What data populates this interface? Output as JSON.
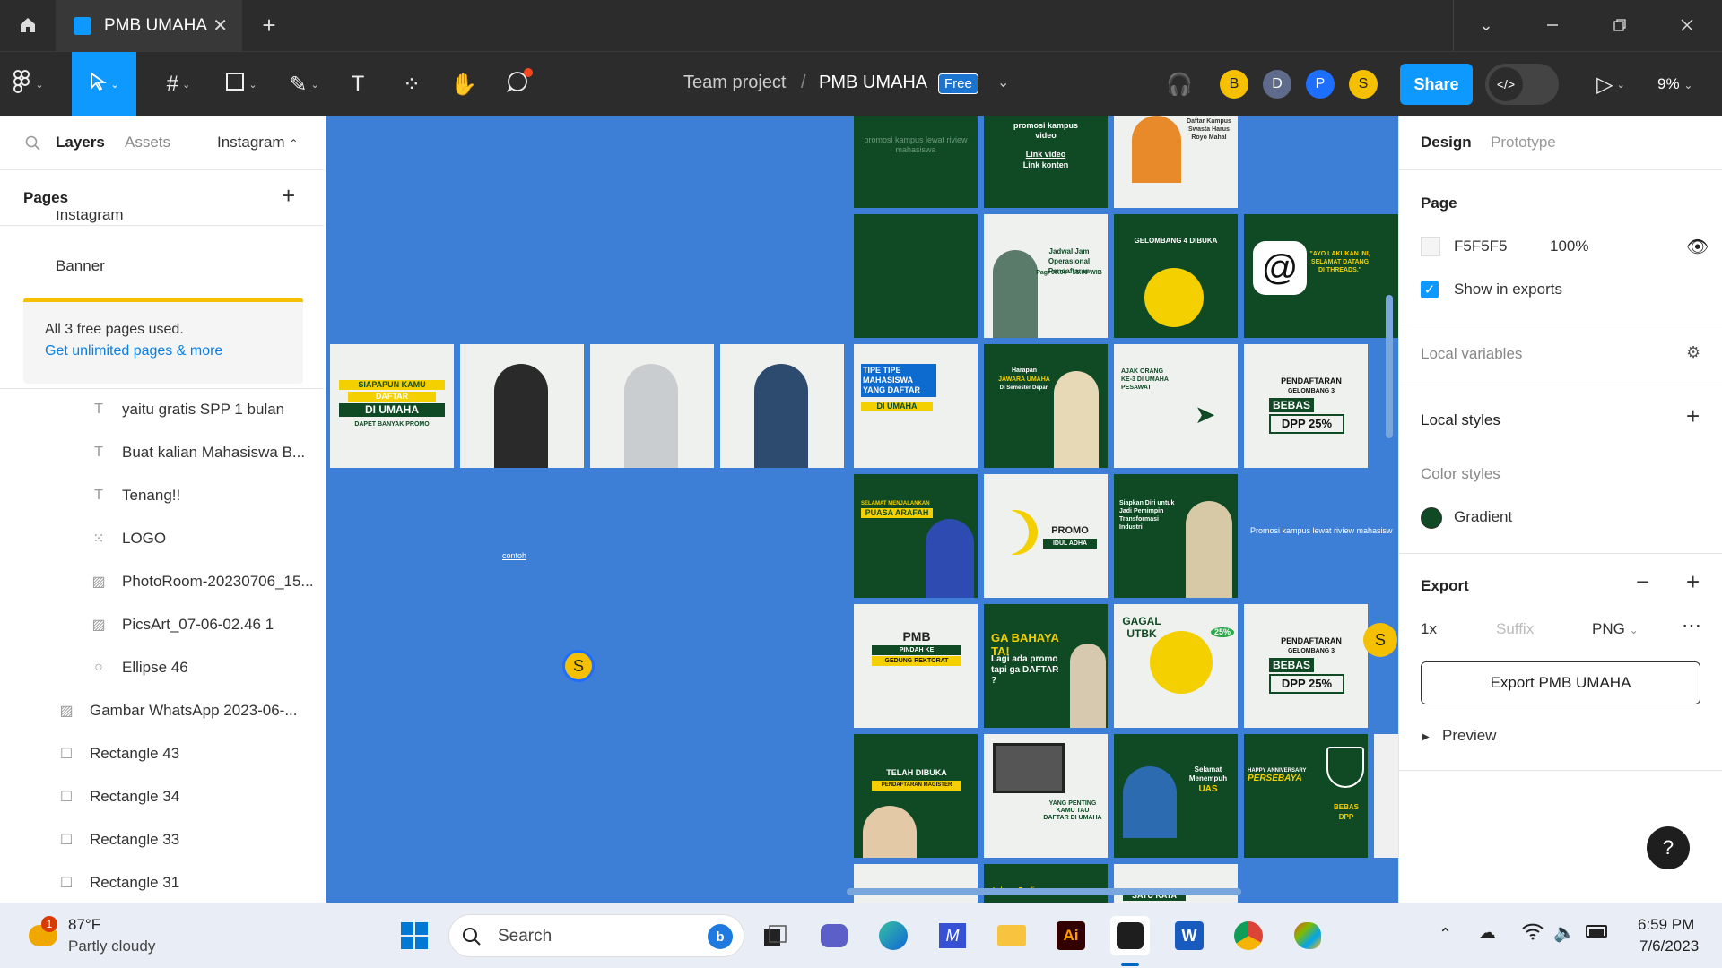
{
  "window": {
    "tab_title": "PMB UMAHA"
  },
  "toolbar": {
    "breadcrumb_team": "Team project",
    "breadcrumb_sep": "/",
    "file_name": "PMB UMAHA",
    "plan_badge": "Free",
    "avatars": [
      "B",
      "D",
      "P",
      "S"
    ],
    "share_label": "Share",
    "zoom": "9%"
  },
  "left_panel": {
    "tabs": [
      "Layers",
      "Assets"
    ],
    "page_selector": "Instagram",
    "pages_header": "Pages",
    "pages": [
      "Instagram",
      "Banner"
    ],
    "notice_text": "All 3 free pages used.",
    "notice_link": "Get unlimited pages & more",
    "layers": [
      {
        "name": "yaitu gratis SPP 1 bulan",
        "icon": "text-icon"
      },
      {
        "name": "Buat kalian Mahasiswa B...",
        "icon": "text-icon"
      },
      {
        "name": "Tenang!!",
        "icon": "text-icon"
      },
      {
        "name": "LOGO",
        "icon": "frame-icon"
      },
      {
        "name": "PhotoRoom-20230706_15...",
        "icon": "image-icon"
      },
      {
        "name": "PicsArt_07-06-02.46 1",
        "icon": "image-icon"
      },
      {
        "name": "Ellipse 46",
        "icon": "ellipse-icon"
      },
      {
        "name": "Gambar WhatsApp 2023-06-...",
        "icon": "image-icon"
      },
      {
        "name": "Rectangle 43",
        "icon": "rectangle-icon"
      },
      {
        "name": "Rectangle 34",
        "icon": "rectangle-icon"
      },
      {
        "name": "Rectangle 33",
        "icon": "rectangle-icon"
      },
      {
        "name": "Rectangle 31",
        "icon": "rectangle-icon"
      }
    ]
  },
  "canvas": {
    "label_contoh": "contoh",
    "label_promo": "Promosi kampus lewat riview mahasisw",
    "label_promo_top": "promosi kampus lewat riview mahasiswa",
    "cursor_user": "S",
    "frames": {
      "video": [
        "promosi kampus",
        "video",
        "Link video",
        "Link konten"
      ],
      "daftar": "Daftar Kampus Swasta Harus Royo Mahal",
      "jadwal": "Jadwal Jam Operasional Pendaftaran",
      "jadwal_time": "Pagi 08.00 - 15.00 WIB",
      "gelombang4": "GELOMBANG 4 DIBUKA",
      "threads": "\"AYO LAKUKAN INI, SELAMAT DATANG DI THREADS.\"",
      "siapapun": [
        "SIAPAPUN KAMU",
        "DAFTAR",
        "DI UMAHA",
        "DAPET BANYAK PROMO"
      ],
      "tipe": [
        "TIPE TIPE MAHASISWA YANG DAFTAR",
        "DI UMAHA"
      ],
      "harapan": [
        "Harapan",
        "JAWARA UMAHA",
        "Di Semester Depan"
      ],
      "ajak": "AJAK ORANG KE-3 DI UMAHA PESAWAT",
      "pendaftaran": [
        "PENDAFTARAN",
        "GELOMBANG 3",
        "BEBAS",
        "DPP 25%"
      ],
      "arafah": [
        "SELAMAT MENJALANKAN",
        "PUASA ARAFAH"
      ],
      "idul": [
        "PROMO",
        "IDUL ADHA"
      ],
      "transformasi": "Siapkan Diri untuk Jadi Pemimpin Transformasi Industri",
      "pindah": [
        "PMB",
        "PINDAH KE",
        "GEDUNG REKTORAT"
      ],
      "gaya": [
        "GA BAHAYA TA!",
        "Lagi ada promo tapi ga DAFTAR ?"
      ],
      "utbk": [
        "GAGAL",
        "UTBK",
        "25%"
      ],
      "telah": [
        "TELAH DIBUKA",
        "PENDAFTARAN MAGISTER"
      ],
      "penting": "YANG PENTING KAMU TAU DAFTAR DI UMAHA",
      "uas": [
        "Selamat",
        "Menempuh",
        "UAS"
      ],
      "anniv": [
        "HAPPY ANNIVERSARY",
        "PERSEBAYA",
        "BEBAS DPP"
      ],
      "bottom": [
        "Lulusan Prodi",
        "SATU KATA"
      ]
    }
  },
  "right_panel": {
    "tabs": [
      "Design",
      "Prototype"
    ],
    "page_header": "Page",
    "page_color": "F5F5F5",
    "page_opacity": "100%",
    "show_in_exports": "Show in exports",
    "local_variables": "Local variables",
    "local_styles": "Local styles",
    "color_styles": "Color styles",
    "gradient_style": "Gradient",
    "export_header": "Export",
    "export_scale": "1x",
    "export_suffix_placeholder": "Suffix",
    "export_format": "PNG",
    "export_button": "Export PMB UMAHA",
    "preview": "Preview",
    "help": "?"
  },
  "taskbar": {
    "weather_badge": "1",
    "temperature": "87°F",
    "weather": "Partly cloudy",
    "search_placeholder": "Search",
    "time": "6:59 PM",
    "date": "7/6/2023"
  },
  "colors": {
    "accent": "#0d99ff",
    "canvas_bg": "#3d7fd6",
    "dark_green": "#0f4a25",
    "avatar_b": "#f5c000",
    "avatar_d": "#5f6b8a",
    "avatar_p": "#1e6fff",
    "avatar_s": "#f5c000"
  }
}
